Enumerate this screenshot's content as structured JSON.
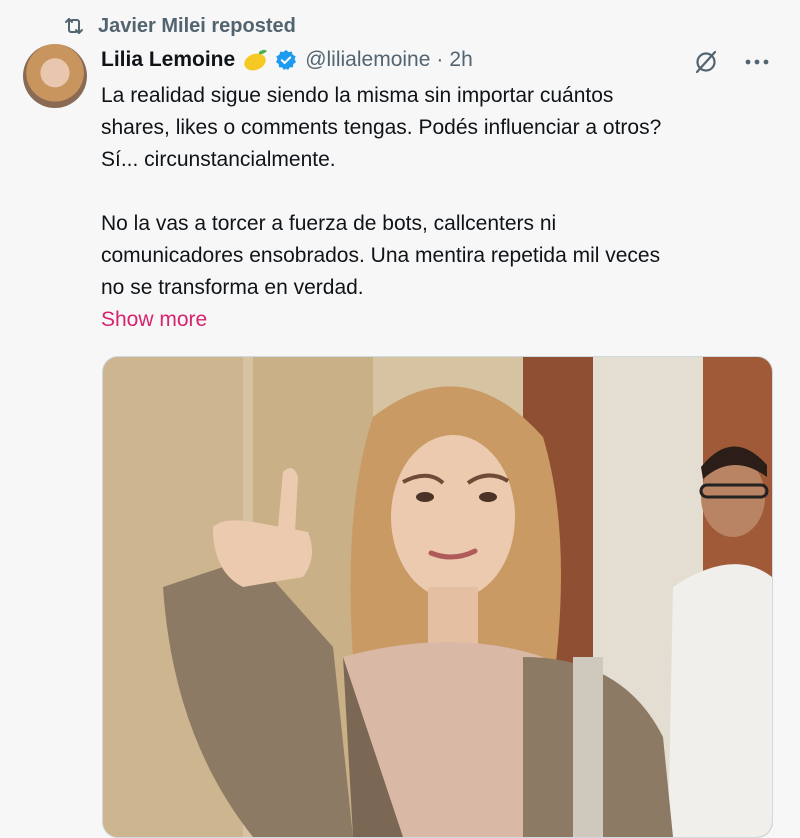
{
  "repost": {
    "label": "Javier Milei reposted",
    "icon": "repost-icon"
  },
  "author": {
    "name": "Lilia Lemoine",
    "emoji": "lemon-emoji",
    "verified_icon": "verified-badge-icon",
    "handle": "@lilialemoine",
    "separator": "·",
    "time": "2h"
  },
  "tweet": {
    "paragraph1": [
      "La realidad sigue siendo la misma sin importar cuántos",
      "shares, likes o comments tengas. Podés influenciar a otros?",
      "Sí... circunstancialmente."
    ],
    "paragraph2": [
      "No la vas a torcer a fuerza de bots, callcenters ni",
      "comunicadores ensobrados. Una mentira repetida mil veces",
      "no se transforma en verdad."
    ],
    "show_more": "Show more"
  },
  "colors": {
    "background": "#f7f7f7",
    "text": "#0f1419",
    "secondary": "#536471",
    "verified": "#1d9bf0",
    "show_more": "#d6246e"
  }
}
